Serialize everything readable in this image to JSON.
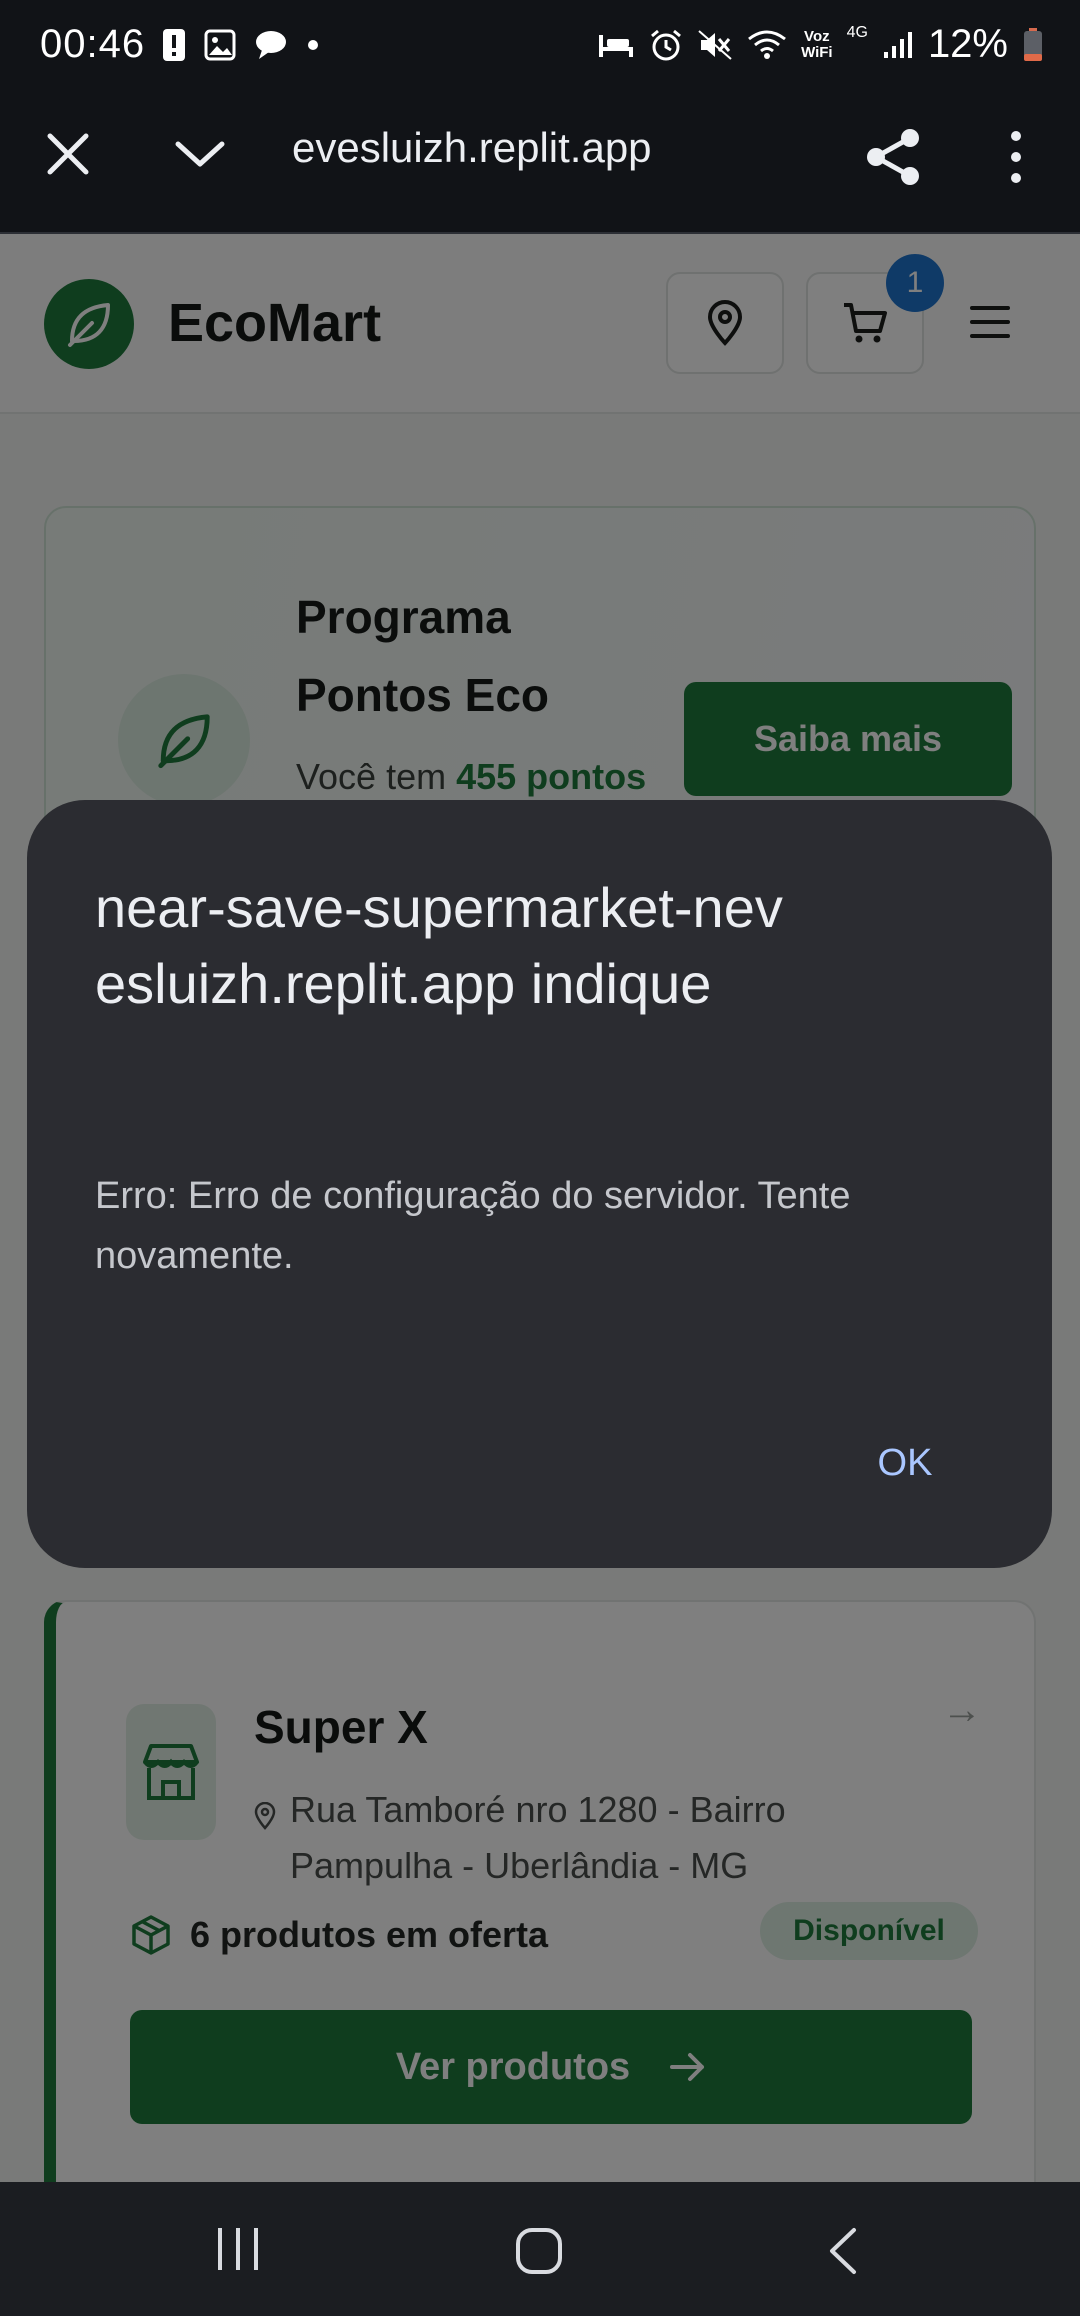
{
  "status_bar": {
    "time": "00:46",
    "battery_percent": "12%",
    "network_voz": "Voz",
    "network_wifi": "WiFi",
    "network_type": "4G",
    "icons": [
      "alert-icon",
      "image-icon",
      "chat-icon",
      "dot-icon",
      "bed-icon",
      "alarm-icon",
      "mute-icon",
      "wifi-icon",
      "signal-icon",
      "battery-icon"
    ]
  },
  "browser": {
    "url": "evesluizh.replit.app",
    "icons": [
      "close-icon",
      "chevron-down-icon",
      "share-icon",
      "more-icon"
    ]
  },
  "site": {
    "brand": "EcoMart",
    "cart_count": "1",
    "icons": [
      "leaf-icon",
      "location-pin-icon",
      "cart-icon",
      "menu-icon"
    ],
    "colors": {
      "accent": "#1e7a3c",
      "badge": "#1f74cf"
    }
  },
  "promo": {
    "title": "Programa Pontos Eco",
    "text_prefix": "Você tem",
    "points": "455 pontos",
    "button": "Saiba mais"
  },
  "store": {
    "name": "Super X",
    "address": "Rua Tamboré nro 1280 - Bairro Pampulha - Uberlândia - MG",
    "offers": "6 produtos em oferta",
    "status": "Disponível",
    "button": "Ver produtos",
    "arrow": "→"
  },
  "dialog": {
    "title": "near-save-supermarket-nevesluizh.replit.app indique",
    "message": "Erro: Erro de configuração do servidor. Tente novamente.",
    "ok": "OK",
    "colors": {
      "background": "#2b2c31",
      "ok": "#aac7ff"
    }
  },
  "nav": {
    "icons": [
      "recent-apps-icon",
      "home-icon",
      "back-icon"
    ]
  }
}
